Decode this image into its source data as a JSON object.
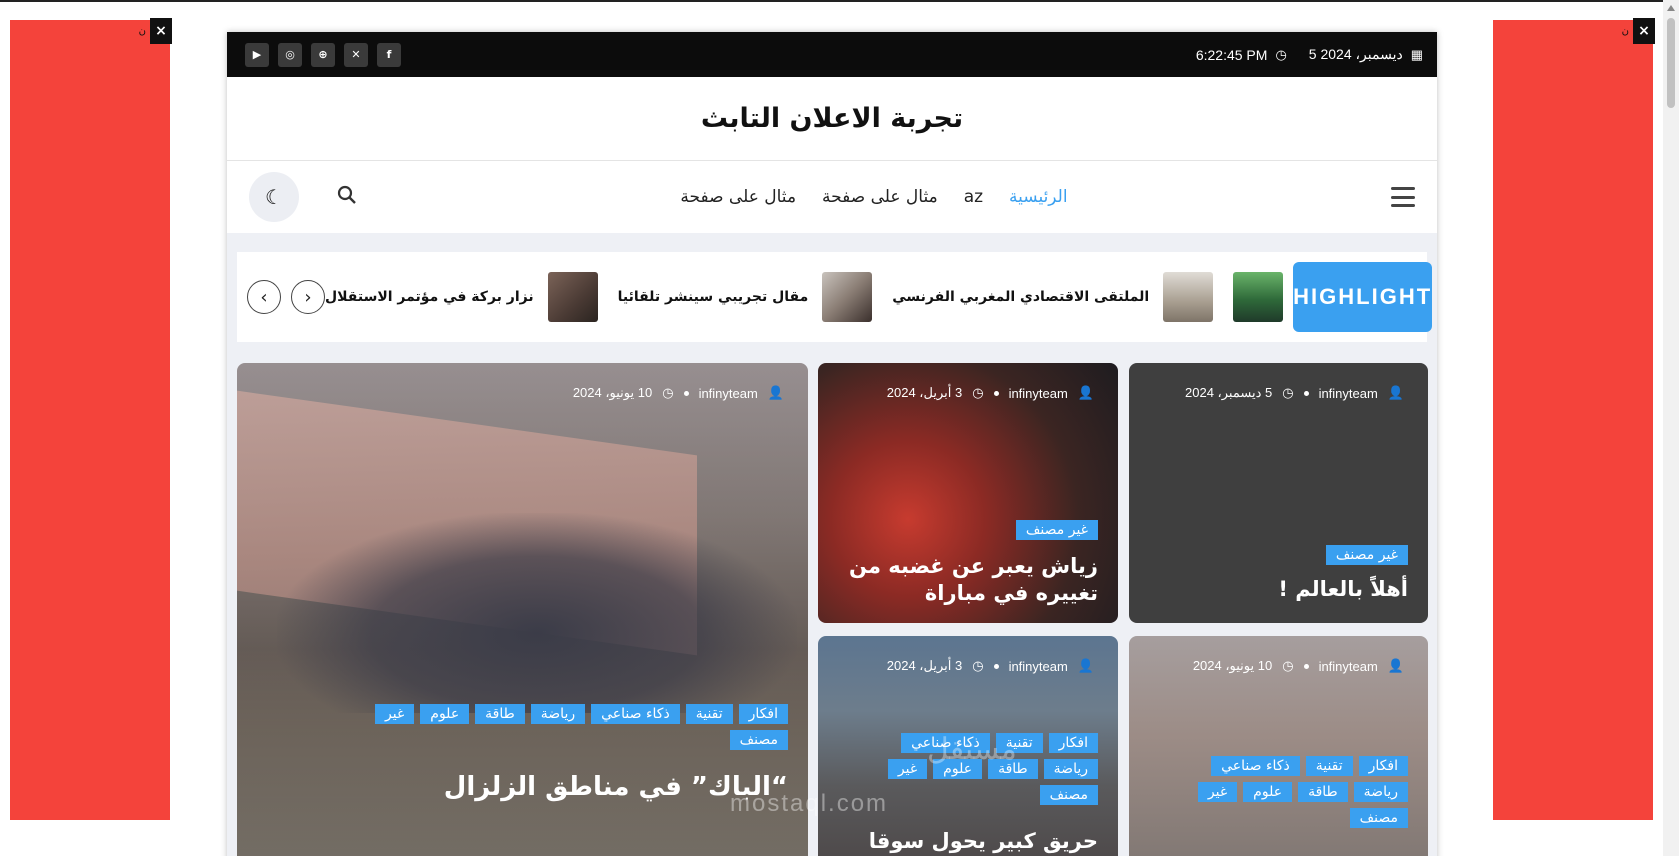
{
  "site": {
    "title": "تجربة الاعلان التابث"
  },
  "topbar": {
    "date": "5 ديسمبر، 2024",
    "time": "6:22:45 PM",
    "socials": [
      "youtube-icon",
      "instagram-icon",
      "dribbble-icon",
      "x-icon",
      "facebook-icon"
    ]
  },
  "nav": {
    "items": [
      "الرئيسية",
      "az",
      "مثال على صفحة",
      "مثال على صفحة"
    ]
  },
  "ticker": {
    "label": "HIGHLIGHT",
    "items": [
      "الملتقى الاقتصادي المغربي الفرنسي",
      "مقال تجريبي سينشر تلقائيا",
      "نزار بركة في مؤتمر الاستقلال"
    ]
  },
  "ads": {
    "close": "×",
    "mini": "ن"
  },
  "cards": {
    "c3": {
      "author": "infinyteam",
      "date": "5 ديسمبر، 2024",
      "tag": "غير مصنف",
      "title": "أهلاً بالعالم !"
    },
    "c2": {
      "author": "infinyteam",
      "date": "3 أبريل، 2024",
      "tag": "غير مصنف",
      "title": "زياش يعبر عن غضبه من تغييره في مباراة"
    },
    "big": {
      "author": "infinyteam",
      "date": "10 يونيو، 2024",
      "tags": [
        "افكار",
        "تقنية",
        "ذكاء صناعي",
        "رياضة",
        "طاقة",
        "علوم",
        "غير",
        "مصنف"
      ],
      "title": "“الباك” في مناطق الزلزال"
    },
    "c4": {
      "author": "infinyteam",
      "date": "3 أبريل، 2024",
      "tags": [
        "افكار",
        "تقنية",
        "ذكاء صناعي",
        "رياضة",
        "طاقة",
        "علوم",
        "غير",
        "مصنف"
      ],
      "title": "حريق كبير يحول سوقا"
    },
    "c5": {
      "author": "infinyteam",
      "date": "10 يونيو، 2024",
      "tags": [
        "افكار",
        "تقنية",
        "ذكاء صناعي",
        "رياضة",
        "طاقة",
        "علوم",
        "غير",
        "مصنف"
      ]
    }
  },
  "watermark": {
    "brand": "مستقل",
    "domain": "mostaql.com"
  },
  "colors": {
    "accent": "#3aa0f0",
    "ad": "#f4433b",
    "topbar": "#0c0c0c"
  }
}
